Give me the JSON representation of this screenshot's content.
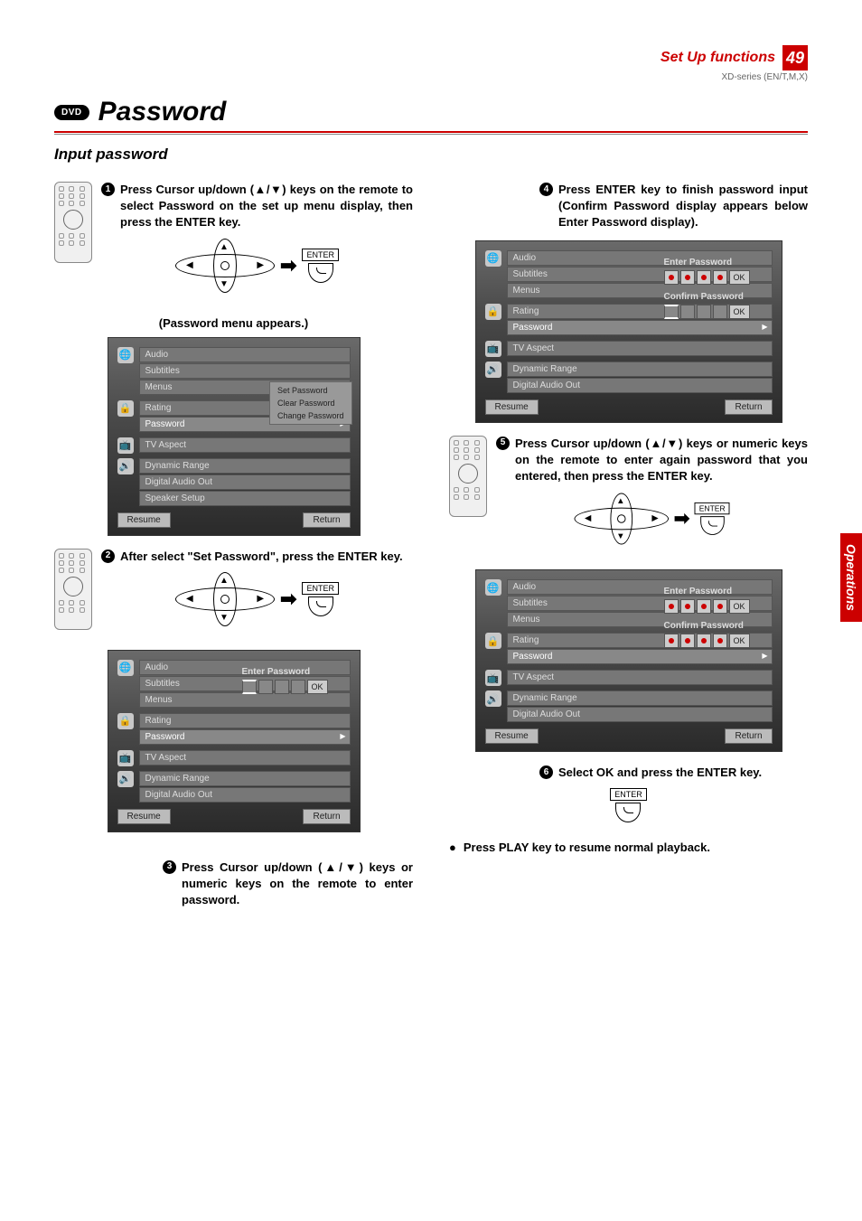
{
  "header": {
    "section": "Set Up functions",
    "page": "49",
    "model": "XD-series (EN/T,M,X)"
  },
  "title": {
    "dvd": "DVD",
    "main": "Password",
    "sub": "Input password"
  },
  "side_tab": "Operations",
  "steps": {
    "s1": "Press Cursor up/down (▲/▼) keys on the remote to select Password on the set up menu display, then press the ENTER key.",
    "s2": "After select \"Set Password\", press the ENTER key.",
    "s3": "Press Cursor up/down (▲/▼) keys or numeric keys on the remote to enter password.",
    "s4": "Press ENTER key to finish password input (Confirm Password display appears below Enter Password display).",
    "s5": "Press Cursor up/down (▲/▼) keys or numeric keys on the remote to enter again password that you entered, then press the ENTER key.",
    "s6": "Select OK and press the ENTER key."
  },
  "notes": {
    "pw_menu": "(Password menu appears.)",
    "play": "Press PLAY key to resume normal playback."
  },
  "labels": {
    "enter": "ENTER"
  },
  "osd": {
    "lang_items": [
      "Audio",
      "Subtitles",
      "Menus"
    ],
    "lock_items": [
      "Rating",
      "Password"
    ],
    "video_items": [
      "TV Aspect"
    ],
    "audio_items_a": [
      "Dynamic Range",
      "Digital Audio Out",
      "Speaker Setup"
    ],
    "audio_items_b": [
      "Dynamic Range",
      "Digital Audio Out"
    ],
    "sub_panel": [
      "Set Password",
      "Clear Password",
      "Change Password"
    ],
    "resume": "Resume",
    "return": "Return",
    "enter_pw": "Enter Password",
    "confirm_pw": "Confirm Password",
    "ok": "OK"
  }
}
